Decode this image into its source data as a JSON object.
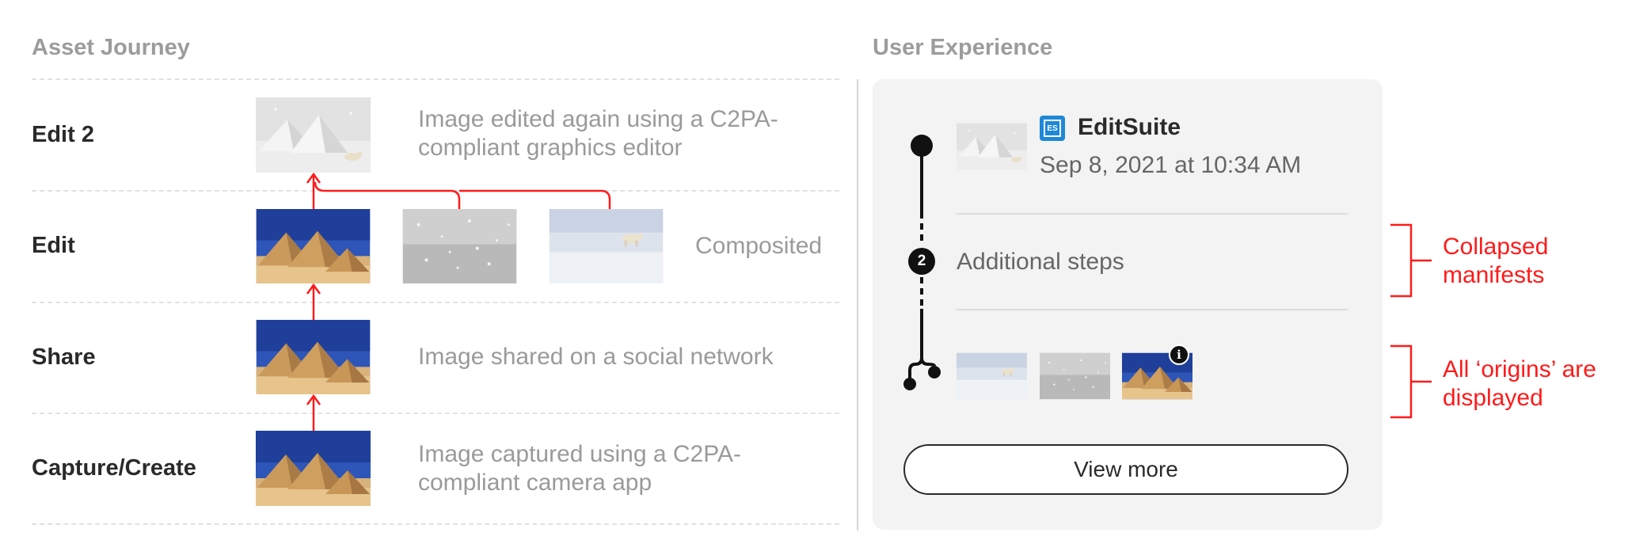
{
  "asset_journey": {
    "title": "Asset Journey",
    "steps": [
      {
        "label": "Edit 2",
        "description": "Image edited again using a C2PA-compliant graphics editor"
      },
      {
        "label": "Edit",
        "description": "Composited"
      },
      {
        "label": "Share",
        "description": "Image shared on a social network"
      },
      {
        "label": "Capture/Create",
        "description": "Image captured using a C2PA-compliant camera app"
      }
    ]
  },
  "user_experience": {
    "title": "User Experience",
    "app_badge": "ES",
    "app_name": "EditSuite",
    "date": "Sep 8, 2021 at 10:34 AM",
    "collapsed_count": "2",
    "collapsed_label": "Additional steps",
    "origins_info_glyph": "i",
    "view_more_label": "View more"
  },
  "annotations": {
    "collapsed": "Collapsed manifests",
    "origins": "All ‘origins’ are displayed"
  },
  "colors": {
    "accent_red": "#ff1a1a",
    "timeline": "#111111",
    "badge_blue": "#1e88d7"
  },
  "icons": [
    "pyramids-thumbnail",
    "snow-thumbnail",
    "polar-bear-thumbnail",
    "composite-thumbnail",
    "info-badge-icon",
    "editsuite-logo-icon"
  ]
}
